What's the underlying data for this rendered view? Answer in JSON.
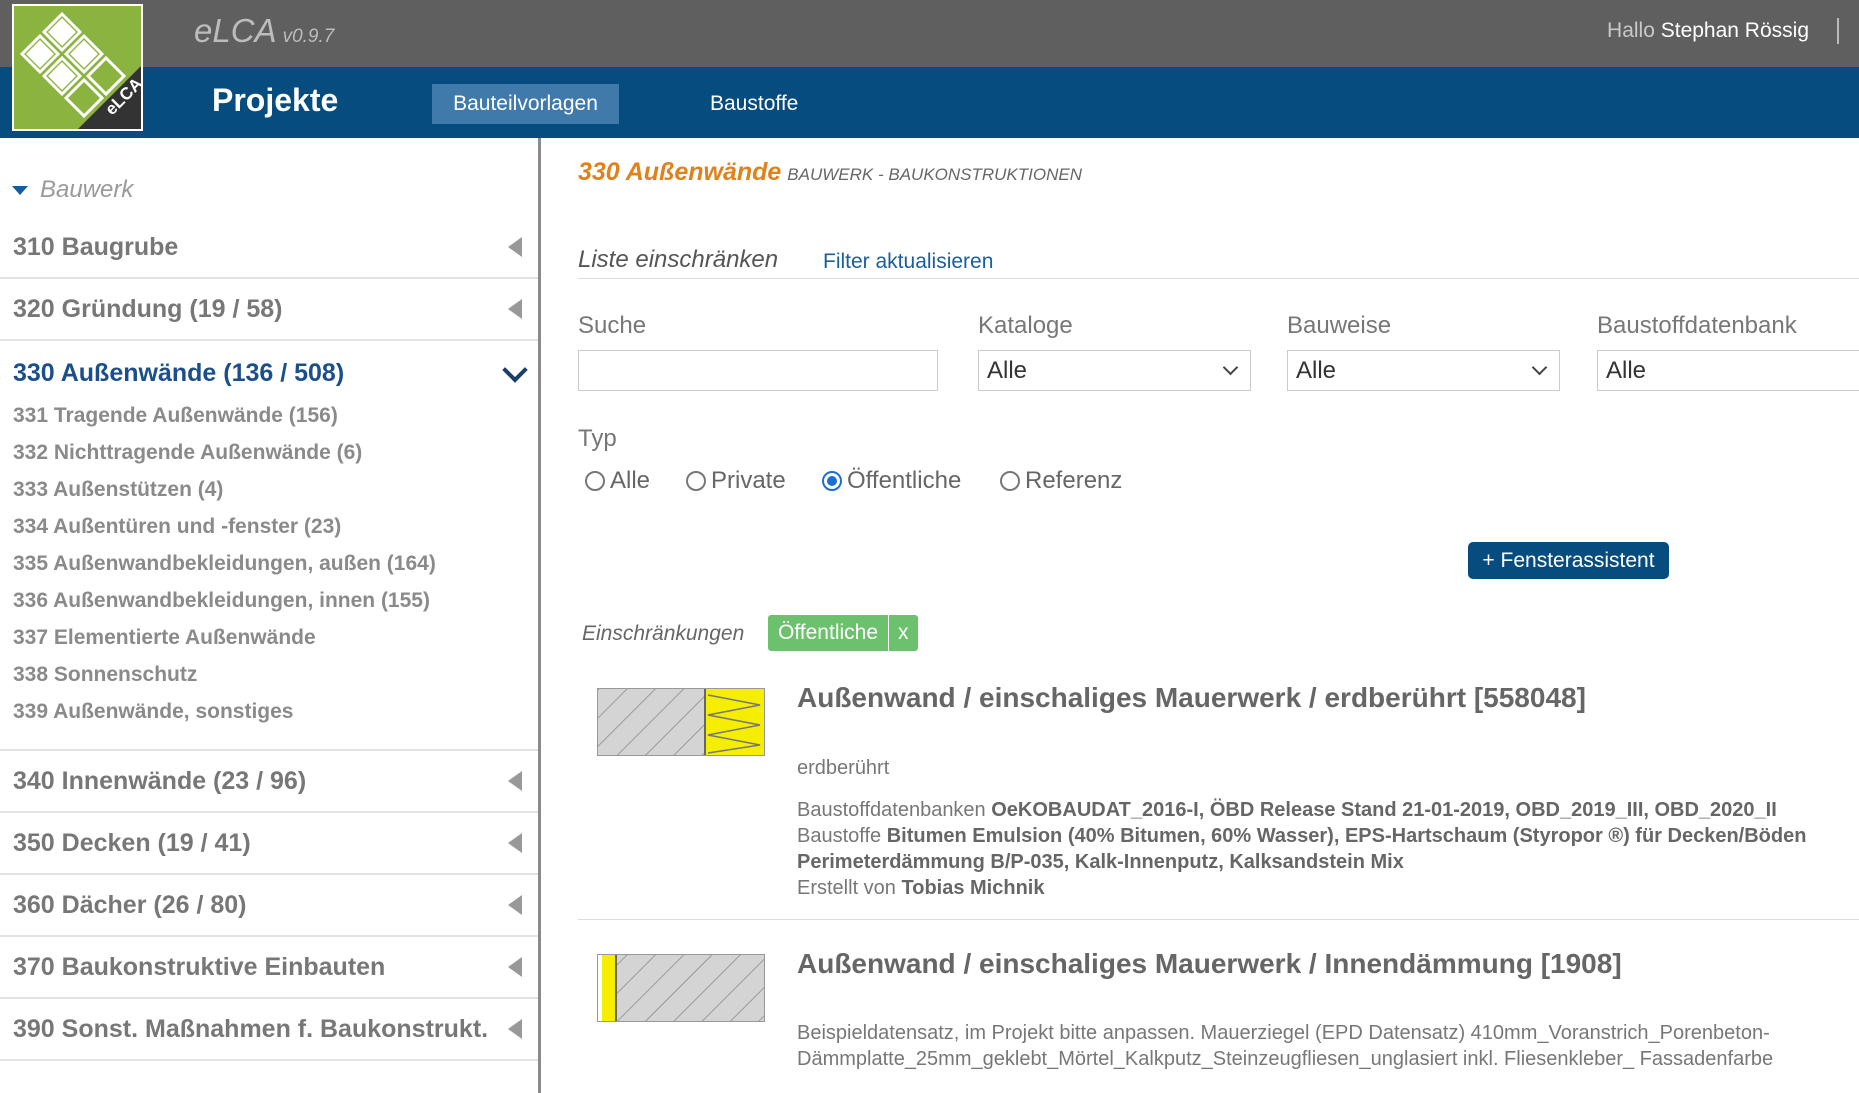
{
  "app": {
    "name": "eLCA",
    "version": "v0.9.7",
    "logo_text": "eLCA"
  },
  "user": {
    "greeting": "Hallo",
    "name": "Stephan Rössig"
  },
  "nav": {
    "projects": "Projekte",
    "active_tab": "Bauteilvorlagen",
    "tab2": "Baustoffe"
  },
  "sidebar": {
    "root": "Bauwerk",
    "categories": [
      {
        "label": "310 Baugrube"
      },
      {
        "label": "320 Gründung (19 / 58)"
      },
      {
        "label": "330 Außenwände (136 / 508)",
        "active": true
      },
      {
        "label": "340 Innenwände (23 / 96)"
      },
      {
        "label": "350 Decken (19 / 41)"
      },
      {
        "label": "360 Dächer (26 / 80)"
      },
      {
        "label": "370 Baukonstruktive Einbauten"
      },
      {
        "label": "390 Sonst. Maßnahmen f. Baukonstrukt."
      }
    ],
    "subcategories": [
      "331 Tragende Außenwände (156)",
      "332 Nichttragende Außenwände (6)",
      "333 Außenstützen (4)",
      "334 Außentüren und -fenster (23)",
      "335 Außenwandbekleidungen, außen (164)",
      "336 Außenwandbekleidungen, innen (155)",
      "337 Elementierte Außenwände",
      "338 Sonnenschutz",
      "339 Außenwände, sonstiges"
    ]
  },
  "main": {
    "title": "330 Außenwände",
    "subtitle": "BAUWERK - BAUKONSTRUKTIONEN",
    "filter_title": "Liste einschränken",
    "filter_refresh": "Filter aktualisieren",
    "search_label": "Suche",
    "search_value": "",
    "kataloge_label": "Kataloge",
    "kataloge_value": "Alle",
    "bauweise_label": "Bauweise",
    "bauweise_value": "Alle",
    "db_label": "Baustoffdatenbank",
    "db_value": "Alle",
    "typ_label": "Typ",
    "typ_options": [
      "Alle",
      "Private",
      "Öffentliche",
      "Referenz"
    ],
    "typ_selected": "Öffentliche",
    "fenster_button": "+ Fensterassistent",
    "restrictions_label": "Einschränkungen",
    "restriction_tag": "Öffentliche",
    "restriction_remove": "x"
  },
  "items": [
    {
      "title": "Außenwand / einschaliges Mauerwerk / erdberührt [558048]",
      "desc": "erdberührt",
      "db_label": "Baustoffdatenbanken",
      "db_values": "OeKOBAUDAT_2016-I, ÖBD Release Stand 21-01-2019, OBD_2019_III, OBD_2020_II",
      "materials_label": "Baustoffe",
      "materials_line1": "Bitumen Emulsion (40% Bitumen, 60% Wasser), EPS-Hartschaum (Styropor ®) für Decken/Böden",
      "materials_line2": "Perimeterdämmung B/P-035, Kalk-Innenputz, Kalksandstein Mix",
      "author_label": "Erstellt von",
      "author": "Tobias Michnik"
    },
    {
      "title": "Außenwand / einschaliges Mauerwerk / Innendämmung [1908]",
      "desc1": "Beispieldatensatz, im Projekt bitte anpassen. Mauerziegel (EPD Datensatz) 410mm_Voranstrich_Porenbeton-",
      "desc2": "Dämmplatte_25mm_geklebt_Mörtel_Kalkputz_Steinzeugfliesen_unglasiert inkl. Fliesenkleber_ Fassadenfarbe"
    }
  ],
  "colors": {
    "topbar": "#5f5f5f",
    "navbar": "#074c7f",
    "accent_orange": "#e0821c",
    "link_blue": "#1b5e9c",
    "tag_green": "#6cc16d",
    "logo_green": "#8ab33f"
  }
}
